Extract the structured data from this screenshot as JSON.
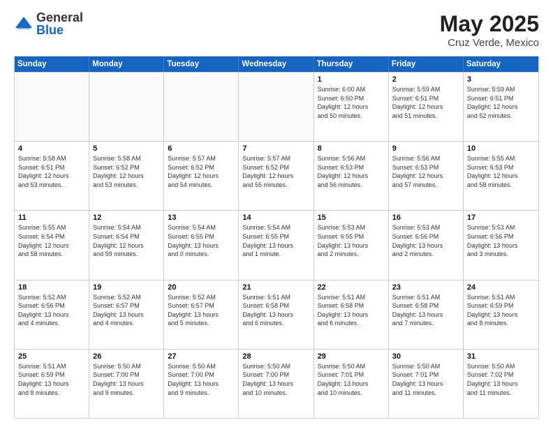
{
  "logo": {
    "general": "General",
    "blue": "Blue"
  },
  "title": {
    "month": "May 2025",
    "location": "Cruz Verde, Mexico"
  },
  "header_days": [
    "Sunday",
    "Monday",
    "Tuesday",
    "Wednesday",
    "Thursday",
    "Friday",
    "Saturday"
  ],
  "rows": [
    [
      {
        "day": "",
        "info": "",
        "empty": true
      },
      {
        "day": "",
        "info": "",
        "empty": true
      },
      {
        "day": "",
        "info": "",
        "empty": true
      },
      {
        "day": "",
        "info": "",
        "empty": true
      },
      {
        "day": "1",
        "info": "Sunrise: 6:00 AM\nSunset: 6:50 PM\nDaylight: 12 hours\nand 50 minutes."
      },
      {
        "day": "2",
        "info": "Sunrise: 5:59 AM\nSunset: 6:51 PM\nDaylight: 12 hours\nand 51 minutes."
      },
      {
        "day": "3",
        "info": "Sunrise: 5:59 AM\nSunset: 6:51 PM\nDaylight: 12 hours\nand 52 minutes."
      }
    ],
    [
      {
        "day": "4",
        "info": "Sunrise: 5:58 AM\nSunset: 6:51 PM\nDaylight: 12 hours\nand 53 minutes."
      },
      {
        "day": "5",
        "info": "Sunrise: 5:58 AM\nSunset: 6:52 PM\nDaylight: 12 hours\nand 53 minutes."
      },
      {
        "day": "6",
        "info": "Sunrise: 5:57 AM\nSunset: 6:52 PM\nDaylight: 12 hours\nand 54 minutes."
      },
      {
        "day": "7",
        "info": "Sunrise: 5:57 AM\nSunset: 6:52 PM\nDaylight: 12 hours\nand 55 minutes."
      },
      {
        "day": "8",
        "info": "Sunrise: 5:56 AM\nSunset: 6:53 PM\nDaylight: 12 hours\nand 56 minutes."
      },
      {
        "day": "9",
        "info": "Sunrise: 5:56 AM\nSunset: 6:53 PM\nDaylight: 12 hours\nand 57 minutes."
      },
      {
        "day": "10",
        "info": "Sunrise: 5:55 AM\nSunset: 6:53 PM\nDaylight: 12 hours\nand 58 minutes."
      }
    ],
    [
      {
        "day": "11",
        "info": "Sunrise: 5:55 AM\nSunset: 6:54 PM\nDaylight: 12 hours\nand 58 minutes."
      },
      {
        "day": "12",
        "info": "Sunrise: 5:54 AM\nSunset: 6:54 PM\nDaylight: 12 hours\nand 59 minutes."
      },
      {
        "day": "13",
        "info": "Sunrise: 5:54 AM\nSunset: 6:55 PM\nDaylight: 13 hours\nand 0 minutes."
      },
      {
        "day": "14",
        "info": "Sunrise: 5:54 AM\nSunset: 6:55 PM\nDaylight: 13 hours\nand 1 minute."
      },
      {
        "day": "15",
        "info": "Sunrise: 5:53 AM\nSunset: 6:55 PM\nDaylight: 13 hours\nand 2 minutes."
      },
      {
        "day": "16",
        "info": "Sunrise: 5:53 AM\nSunset: 6:56 PM\nDaylight: 13 hours\nand 2 minutes."
      },
      {
        "day": "17",
        "info": "Sunrise: 5:53 AM\nSunset: 6:56 PM\nDaylight: 13 hours\nand 3 minutes."
      }
    ],
    [
      {
        "day": "18",
        "info": "Sunrise: 5:52 AM\nSunset: 6:56 PM\nDaylight: 13 hours\nand 4 minutes."
      },
      {
        "day": "19",
        "info": "Sunrise: 5:52 AM\nSunset: 6:57 PM\nDaylight: 13 hours\nand 4 minutes."
      },
      {
        "day": "20",
        "info": "Sunrise: 5:52 AM\nSunset: 6:57 PM\nDaylight: 13 hours\nand 5 minutes."
      },
      {
        "day": "21",
        "info": "Sunrise: 5:51 AM\nSunset: 6:58 PM\nDaylight: 13 hours\nand 6 minutes."
      },
      {
        "day": "22",
        "info": "Sunrise: 5:51 AM\nSunset: 6:58 PM\nDaylight: 13 hours\nand 6 minutes."
      },
      {
        "day": "23",
        "info": "Sunrise: 5:51 AM\nSunset: 6:58 PM\nDaylight: 13 hours\nand 7 minutes."
      },
      {
        "day": "24",
        "info": "Sunrise: 5:51 AM\nSunset: 6:59 PM\nDaylight: 13 hours\nand 8 minutes."
      }
    ],
    [
      {
        "day": "25",
        "info": "Sunrise: 5:51 AM\nSunset: 6:59 PM\nDaylight: 13 hours\nand 8 minutes."
      },
      {
        "day": "26",
        "info": "Sunrise: 5:50 AM\nSunset: 7:00 PM\nDaylight: 13 hours\nand 9 minutes."
      },
      {
        "day": "27",
        "info": "Sunrise: 5:50 AM\nSunset: 7:00 PM\nDaylight: 13 hours\nand 9 minutes."
      },
      {
        "day": "28",
        "info": "Sunrise: 5:50 AM\nSunset: 7:00 PM\nDaylight: 13 hours\nand 10 minutes."
      },
      {
        "day": "29",
        "info": "Sunrise: 5:50 AM\nSunset: 7:01 PM\nDaylight: 13 hours\nand 10 minutes."
      },
      {
        "day": "30",
        "info": "Sunrise: 5:50 AM\nSunset: 7:01 PM\nDaylight: 13 hours\nand 11 minutes."
      },
      {
        "day": "31",
        "info": "Sunrise: 5:50 AM\nSunset: 7:02 PM\nDaylight: 13 hours\nand 11 minutes."
      }
    ]
  ]
}
